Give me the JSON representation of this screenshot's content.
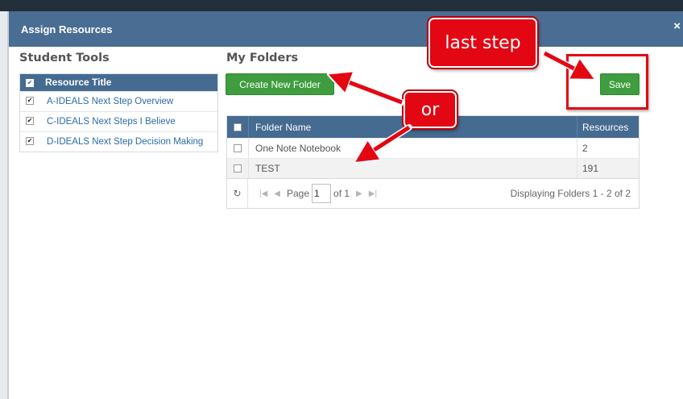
{
  "modal": {
    "title": "Assign Resources",
    "close_icon": "close-icon",
    "close_glyph": "×"
  },
  "student_tools": {
    "title": "Student Tools",
    "header_label": "Resource Title",
    "header_checked": true,
    "items": [
      {
        "label": "A-IDEALS Next Step Overview",
        "checked": true
      },
      {
        "label": "C-IDEALS Next Steps I Believe",
        "checked": true
      },
      {
        "label": "D-IDEALS Next Step Decision Making",
        "checked": true
      }
    ]
  },
  "my_folders": {
    "title": "My Folders",
    "create_button_label": "Create New Folder",
    "save_button_label": "Save",
    "columns": {
      "name": "Folder Name",
      "resources": "Resources"
    },
    "rows": [
      {
        "name": "One Note Notebook",
        "resources": "2",
        "checked": false
      },
      {
        "name": "TEST",
        "resources": "191",
        "checked": false
      }
    ],
    "pager": {
      "page_label": "Page",
      "page_value": "1",
      "of_label": "of 1",
      "status": "Displaying Folders 1 - 2 of 2"
    }
  },
  "annotations": {
    "last_step_label": "last step",
    "or_label": "or",
    "color": "#e30613"
  }
}
